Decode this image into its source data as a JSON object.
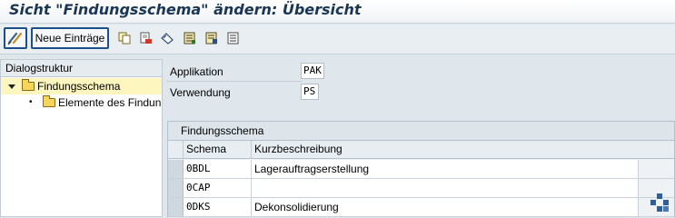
{
  "window": {
    "title": "Sicht \"Findungsschema\" ändern: Übersicht"
  },
  "toolbar": {
    "edit_icon": "display-change-icon",
    "neue_label": "Neue Einträge",
    "icons": [
      "copy-icon",
      "delete-icon",
      "undo-icon",
      "select-all-icon",
      "select-block-icon",
      "deselect-all-icon"
    ]
  },
  "dialog": {
    "header": "Dialogstruktur",
    "items": [
      {
        "label": "Findungsschema",
        "expanded": true,
        "selected": true
      },
      {
        "label": "Elemente des Findun",
        "expanded": false,
        "selected": false
      }
    ]
  },
  "fields": {
    "applikation_label": "Applikation",
    "applikation_value": "PAK",
    "verwendung_label": "Verwendung",
    "verwendung_value": "PS"
  },
  "table": {
    "title": "Findungsschema",
    "columns": [
      "Schema",
      "Kurzbeschreibung"
    ],
    "rows": [
      {
        "schema": "0BDL",
        "desc": "Lagerauftragserstellung"
      },
      {
        "schema": "0CAP",
        "desc": ""
      },
      {
        "schema": "0DKS",
        "desc": "Dekonsolidierung"
      }
    ]
  },
  "colors": {
    "title": "#1a3652",
    "button_border": "#1d4f8a",
    "selected_row": "#fdf6bf",
    "background": "#dfe6ec"
  }
}
